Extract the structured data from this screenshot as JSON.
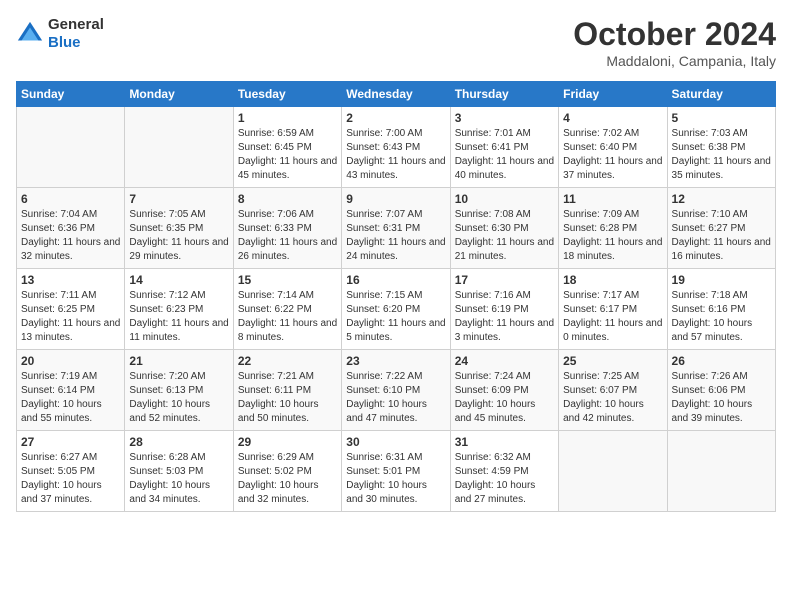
{
  "header": {
    "logo_general": "General",
    "logo_blue": "Blue",
    "month": "October 2024",
    "location": "Maddaloni, Campania, Italy"
  },
  "days_of_week": [
    "Sunday",
    "Monday",
    "Tuesday",
    "Wednesday",
    "Thursday",
    "Friday",
    "Saturday"
  ],
  "weeks": [
    [
      {
        "day": "",
        "empty": true
      },
      {
        "day": "",
        "empty": true
      },
      {
        "day": "1",
        "sunrise": "Sunrise: 6:59 AM",
        "sunset": "Sunset: 6:45 PM",
        "daylight": "Daylight: 11 hours and 45 minutes."
      },
      {
        "day": "2",
        "sunrise": "Sunrise: 7:00 AM",
        "sunset": "Sunset: 6:43 PM",
        "daylight": "Daylight: 11 hours and 43 minutes."
      },
      {
        "day": "3",
        "sunrise": "Sunrise: 7:01 AM",
        "sunset": "Sunset: 6:41 PM",
        "daylight": "Daylight: 11 hours and 40 minutes."
      },
      {
        "day": "4",
        "sunrise": "Sunrise: 7:02 AM",
        "sunset": "Sunset: 6:40 PM",
        "daylight": "Daylight: 11 hours and 37 minutes."
      },
      {
        "day": "5",
        "sunrise": "Sunrise: 7:03 AM",
        "sunset": "Sunset: 6:38 PM",
        "daylight": "Daylight: 11 hours and 35 minutes."
      }
    ],
    [
      {
        "day": "6",
        "sunrise": "Sunrise: 7:04 AM",
        "sunset": "Sunset: 6:36 PM",
        "daylight": "Daylight: 11 hours and 32 minutes."
      },
      {
        "day": "7",
        "sunrise": "Sunrise: 7:05 AM",
        "sunset": "Sunset: 6:35 PM",
        "daylight": "Daylight: 11 hours and 29 minutes."
      },
      {
        "day": "8",
        "sunrise": "Sunrise: 7:06 AM",
        "sunset": "Sunset: 6:33 PM",
        "daylight": "Daylight: 11 hours and 26 minutes."
      },
      {
        "day": "9",
        "sunrise": "Sunrise: 7:07 AM",
        "sunset": "Sunset: 6:31 PM",
        "daylight": "Daylight: 11 hours and 24 minutes."
      },
      {
        "day": "10",
        "sunrise": "Sunrise: 7:08 AM",
        "sunset": "Sunset: 6:30 PM",
        "daylight": "Daylight: 11 hours and 21 minutes."
      },
      {
        "day": "11",
        "sunrise": "Sunrise: 7:09 AM",
        "sunset": "Sunset: 6:28 PM",
        "daylight": "Daylight: 11 hours and 18 minutes."
      },
      {
        "day": "12",
        "sunrise": "Sunrise: 7:10 AM",
        "sunset": "Sunset: 6:27 PM",
        "daylight": "Daylight: 11 hours and 16 minutes."
      }
    ],
    [
      {
        "day": "13",
        "sunrise": "Sunrise: 7:11 AM",
        "sunset": "Sunset: 6:25 PM",
        "daylight": "Daylight: 11 hours and 13 minutes."
      },
      {
        "day": "14",
        "sunrise": "Sunrise: 7:12 AM",
        "sunset": "Sunset: 6:23 PM",
        "daylight": "Daylight: 11 hours and 11 minutes."
      },
      {
        "day": "15",
        "sunrise": "Sunrise: 7:14 AM",
        "sunset": "Sunset: 6:22 PM",
        "daylight": "Daylight: 11 hours and 8 minutes."
      },
      {
        "day": "16",
        "sunrise": "Sunrise: 7:15 AM",
        "sunset": "Sunset: 6:20 PM",
        "daylight": "Daylight: 11 hours and 5 minutes."
      },
      {
        "day": "17",
        "sunrise": "Sunrise: 7:16 AM",
        "sunset": "Sunset: 6:19 PM",
        "daylight": "Daylight: 11 hours and 3 minutes."
      },
      {
        "day": "18",
        "sunrise": "Sunrise: 7:17 AM",
        "sunset": "Sunset: 6:17 PM",
        "daylight": "Daylight: 11 hours and 0 minutes."
      },
      {
        "day": "19",
        "sunrise": "Sunrise: 7:18 AM",
        "sunset": "Sunset: 6:16 PM",
        "daylight": "Daylight: 10 hours and 57 minutes."
      }
    ],
    [
      {
        "day": "20",
        "sunrise": "Sunrise: 7:19 AM",
        "sunset": "Sunset: 6:14 PM",
        "daylight": "Daylight: 10 hours and 55 minutes."
      },
      {
        "day": "21",
        "sunrise": "Sunrise: 7:20 AM",
        "sunset": "Sunset: 6:13 PM",
        "daylight": "Daylight: 10 hours and 52 minutes."
      },
      {
        "day": "22",
        "sunrise": "Sunrise: 7:21 AM",
        "sunset": "Sunset: 6:11 PM",
        "daylight": "Daylight: 10 hours and 50 minutes."
      },
      {
        "day": "23",
        "sunrise": "Sunrise: 7:22 AM",
        "sunset": "Sunset: 6:10 PM",
        "daylight": "Daylight: 10 hours and 47 minutes."
      },
      {
        "day": "24",
        "sunrise": "Sunrise: 7:24 AM",
        "sunset": "Sunset: 6:09 PM",
        "daylight": "Daylight: 10 hours and 45 minutes."
      },
      {
        "day": "25",
        "sunrise": "Sunrise: 7:25 AM",
        "sunset": "Sunset: 6:07 PM",
        "daylight": "Daylight: 10 hours and 42 minutes."
      },
      {
        "day": "26",
        "sunrise": "Sunrise: 7:26 AM",
        "sunset": "Sunset: 6:06 PM",
        "daylight": "Daylight: 10 hours and 39 minutes."
      }
    ],
    [
      {
        "day": "27",
        "sunrise": "Sunrise: 6:27 AM",
        "sunset": "Sunset: 5:05 PM",
        "daylight": "Daylight: 10 hours and 37 minutes."
      },
      {
        "day": "28",
        "sunrise": "Sunrise: 6:28 AM",
        "sunset": "Sunset: 5:03 PM",
        "daylight": "Daylight: 10 hours and 34 minutes."
      },
      {
        "day": "29",
        "sunrise": "Sunrise: 6:29 AM",
        "sunset": "Sunset: 5:02 PM",
        "daylight": "Daylight: 10 hours and 32 minutes."
      },
      {
        "day": "30",
        "sunrise": "Sunrise: 6:31 AM",
        "sunset": "Sunset: 5:01 PM",
        "daylight": "Daylight: 10 hours and 30 minutes."
      },
      {
        "day": "31",
        "sunrise": "Sunrise: 6:32 AM",
        "sunset": "Sunset: 4:59 PM",
        "daylight": "Daylight: 10 hours and 27 minutes."
      },
      {
        "day": "",
        "empty": true
      },
      {
        "day": "",
        "empty": true
      }
    ]
  ]
}
